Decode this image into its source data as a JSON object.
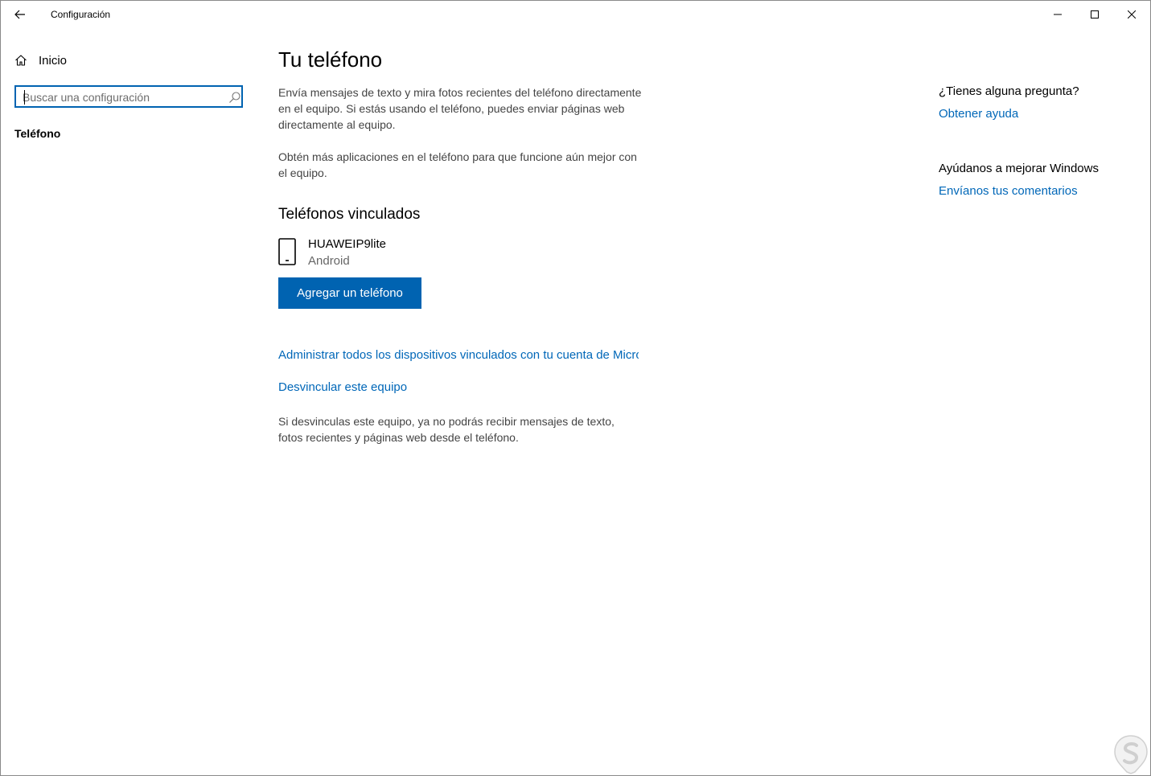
{
  "titlebar": {
    "title": "Configuración"
  },
  "sidebar": {
    "home_label": "Inicio",
    "search_placeholder": "Buscar una configuración",
    "section_label": "Teléfono"
  },
  "main": {
    "title": "Tu teléfono",
    "description_1": "Envía mensajes de texto y mira fotos recientes del teléfono directamente en el equipo. Si estás usando el teléfono, puedes enviar páginas web directamente al equipo.",
    "description_2": "Obtén más aplicaciones en el teléfono para que funcione aún mejor con el equipo.",
    "linked_phones_title": "Teléfonos vinculados",
    "device": {
      "name": "HUAWEIP9lite",
      "os": "Android"
    },
    "add_phone_button": "Agregar un teléfono",
    "manage_devices_link": "Administrar todos los dispositivos vinculados con tu cuenta de Microsoft",
    "unlink_link": "Desvincular este equipo",
    "unlink_description": "Si desvinculas este equipo, ya no podrás recibir mensajes de texto, fotos recientes y páginas web desde el teléfono."
  },
  "aside": {
    "question_title": "¿Tienes alguna pregunta?",
    "help_link": "Obtener ayuda",
    "improve_title": "Ayúdanos a mejorar Windows",
    "feedback_link": "Envíanos tus comentarios"
  },
  "icons": {
    "back": "back-arrow-icon",
    "minimize": "minimize-icon",
    "maximize": "maximize-icon",
    "close": "close-icon",
    "home": "home-icon",
    "search": "search-icon",
    "phone": "phone-icon"
  },
  "colors": {
    "accent": "#0063b1",
    "link": "#0067b8",
    "focus_border": "#0063b1"
  }
}
